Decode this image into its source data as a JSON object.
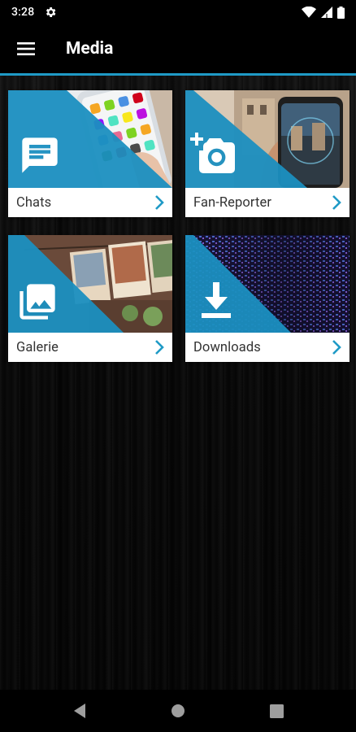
{
  "status_bar": {
    "time": "3:28",
    "icons": [
      "gear-icon",
      "wifi-icon",
      "signal-icon",
      "battery-icon"
    ]
  },
  "app_bar": {
    "title": "Media",
    "menu_icon": "hamburger-menu-icon"
  },
  "colors": {
    "accent": "#1f9ac6",
    "tile_overlay": "#1b8fc0",
    "caption_text": "#333333",
    "chevron": "#1f9ac6"
  },
  "tiles": [
    {
      "label": "Chats",
      "icon": "chat-bubble-icon",
      "image": "smartphone-photo"
    },
    {
      "label": "Fan-Reporter",
      "icon": "add-camera-icon",
      "image": "phone-city-photo"
    },
    {
      "label": "Galerie",
      "icon": "photo-library-icon",
      "image": "hanging-photos"
    },
    {
      "label": "Downloads",
      "icon": "download-icon",
      "image": "digital-matrix"
    }
  ],
  "nav_bar": {
    "buttons": [
      "back-triangle-icon",
      "home-circle-icon",
      "recents-square-icon"
    ]
  }
}
